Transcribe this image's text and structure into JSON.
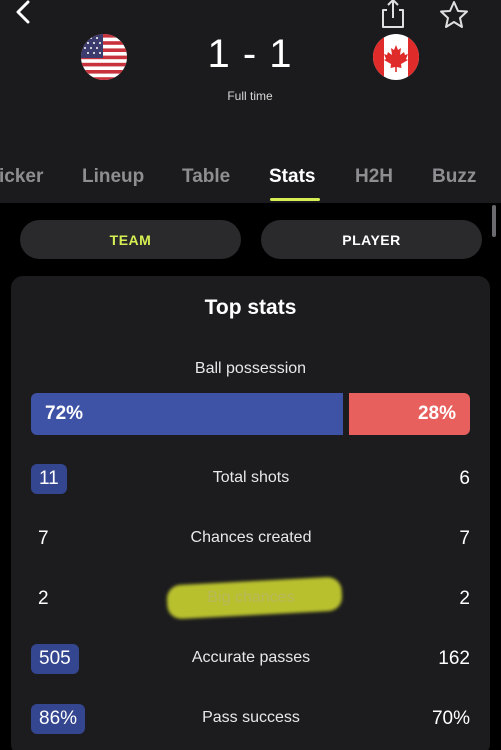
{
  "header": {
    "back_icon": "chevron-left-icon",
    "share_icon": "share-icon",
    "favorite_icon": "star-icon",
    "home_flag": "usa-flag",
    "away_flag": "canada-flag",
    "score": "1 - 1",
    "status": "Full time"
  },
  "tabs": [
    {
      "label": "icker"
    },
    {
      "label": "Lineup"
    },
    {
      "label": "Table"
    },
    {
      "label": "Stats",
      "active": true
    },
    {
      "label": "H2H"
    },
    {
      "label": "Buzz"
    }
  ],
  "toggle": {
    "team_label": "TEAM",
    "player_label": "PLAYER",
    "selected": "TEAM"
  },
  "card": {
    "title": "Top stats",
    "possession": {
      "label": "Ball possession",
      "home": "72%",
      "away": "28%",
      "home_fraction": 0.72
    },
    "stats": [
      {
        "label": "Total shots",
        "home": "11",
        "away": "6",
        "home_highlight": true
      },
      {
        "label": "Chances created",
        "home": "7",
        "away": "7",
        "home_highlight": false
      },
      {
        "label": "Big chances",
        "home": "2",
        "away": "2",
        "home_highlight": false
      },
      {
        "label": "Accurate passes",
        "home": "505",
        "away": "162",
        "home_highlight": true
      },
      {
        "label": "Pass success",
        "home": "86%",
        "away": "70%",
        "home_highlight": true
      }
    ]
  },
  "colors": {
    "accent": "#d7ef52",
    "home": "#3f53a6",
    "away": "#e8605d",
    "highlighter": "#e5ef33"
  }
}
